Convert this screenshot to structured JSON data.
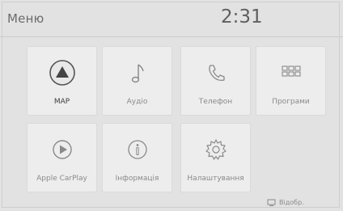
{
  "header": {
    "title": "Меню",
    "clock": "2:31"
  },
  "tiles": [
    {
      "label": "MAP",
      "icon": "map-icon"
    },
    {
      "label": "Аудіо",
      "icon": "music-note-icon"
    },
    {
      "label": "Телефон",
      "icon": "phone-icon"
    },
    {
      "label": "Програми",
      "icon": "apps-grid-icon"
    },
    {
      "label": "Apple CarPlay",
      "icon": "carplay-icon"
    },
    {
      "label": "Інформація",
      "icon": "info-icon"
    },
    {
      "label": "Налаштування",
      "icon": "settings-gear-icon"
    }
  ],
  "footer": {
    "back_label": "Відобр."
  },
  "colors": {
    "background": "#e2e2e2",
    "tile": "#ededed",
    "text": "#8a8a8a"
  }
}
